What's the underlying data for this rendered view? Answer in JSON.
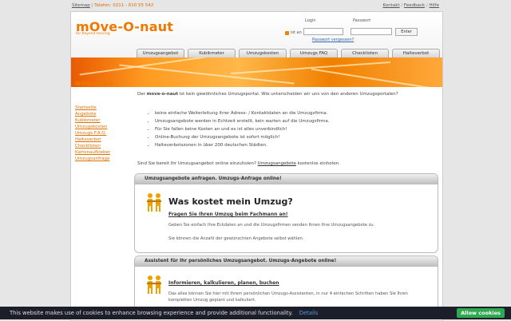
{
  "topbar": {
    "sitemap": "Sitemap",
    "separator": " | ",
    "phone": "Telefon: 0211 - 610 55 542",
    "contact": "Kontakt",
    "sep2": " / ",
    "feedback": "Feedback",
    "help": "Hilfe"
  },
  "brand": {
    "logo": "mOve-O-naut",
    "tagline": "for beyond moving"
  },
  "login": {
    "ist_an": "ist an",
    "login_label": "Login",
    "password_label": "Passwort",
    "login_value": "",
    "password_value": "",
    "enter": "Enter",
    "forgot": "Passwort vergessen?"
  },
  "tabs": [
    "Umzugsangebot",
    "Kubikmeter",
    "Umzugskosten",
    "Umzugs FAQ",
    "Checklisten",
    "Halteverbot"
  ],
  "sidebar": {
    "title": "Willkommen",
    "links": [
      "Startseite",
      "Angebote",
      "Kubikmeter",
      "Umzugskosten",
      "Umzugs F.A.Q.",
      "Halteverbot",
      "Checklisten",
      "Kartonaufkleber",
      "Umzugsanfrage"
    ]
  },
  "main": {
    "intro_pre": "Der ",
    "intro_brand": "move-o-naut",
    "intro_post": " ist kein gewöhnliches Umzugsportal. Wie unterscheiden wir uns von den anderen Umzugsportalen?",
    "bullets": [
      "keine einfache Weiterleitung ihrer Adress- / Kontaktdaten an die Umzugsfirma.",
      "Umzugsangebote werden in Echtzeit erstellt, kein warten auf die Umzugsfirma.",
      "Für Sie fallen keine Kosten an und es ist alles unverbindlich!",
      "Online-Buchung der Umzugsangebote ist sofort möglich!",
      "Halteverbotszonen in über 200 deutschen Städten."
    ],
    "cta_pre": "Sind Sie bereit Ihr Umzugsangebot online einzuholen? ",
    "cta_link": "Umzugsangebote",
    "cta_post": " kostenlos einholen."
  },
  "box1": {
    "header": "Umzugsangebote anfragen. Umzugs-Anfrage online!",
    "title": "Was kostet mein Umzug?",
    "subtitle": "Fragen Sie Ihren Umzug beim Fachmann an!",
    "text1": "Geben Sie einfach Ihre Eckdaten an und die Umzugsfirmen senden Ihnen Ihre Umzugsangebote zu.",
    "text2": "Sie können die Anzahl der gewünschten Angebote selbst wählen."
  },
  "box2": {
    "header": "Assistent für Ihr persönliches Umzugsangebot. Umzugs-Angebote online!",
    "subtitle": "Informieren, kalkulieren, planen, buchen",
    "text1": "Das alles können Sie hier mit Ihrem persönlichen Umzugs-Assistenten, in nur 4 einfachen Schritten haben Sie Ihren kompletten Umzug geplant und kalkuliert."
  },
  "cookie": {
    "text": "This website makes use of cookies to enhance browsing experience and provide additional functionality.",
    "details": "Details",
    "button": "Allow cookies"
  },
  "colors": {
    "accent": "#f07800",
    "cookie_bg": "#1c1f2a",
    "cookie_btn": "#2fa84f"
  },
  "icons": {
    "lock": "lock-icon",
    "people": "people-icon"
  }
}
